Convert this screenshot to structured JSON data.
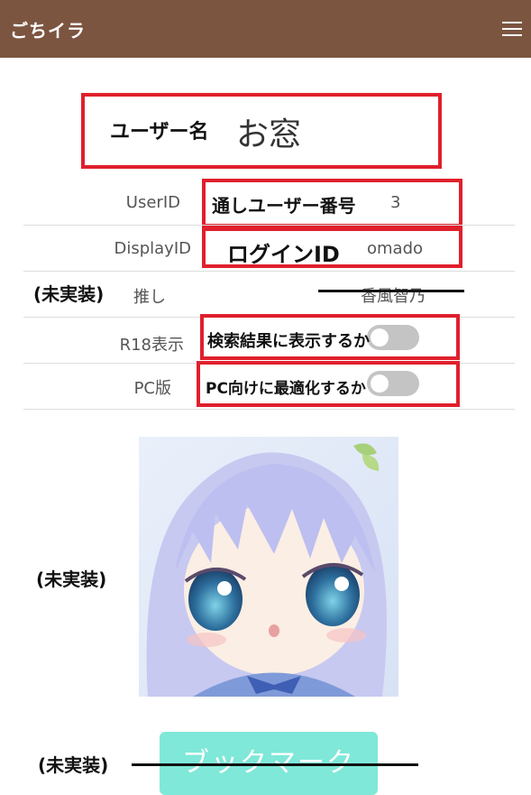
{
  "header": {
    "title": "ごちイラ",
    "menu_icon": "hamburger-menu-icon",
    "background": "#7c5541"
  },
  "profile": {
    "username_annotation": "ユーザー名",
    "username": "お窓",
    "rows": {
      "userid": {
        "label": "UserID",
        "annotation": "通しユーザー番号",
        "value": "3"
      },
      "displayid": {
        "label": "DisplayID",
        "annotation": "ログインID",
        "value": "omado"
      },
      "oshi": {
        "label": "推し",
        "annotation": "(未実装)",
        "value": "香風智乃"
      },
      "r18": {
        "label": "R18表示",
        "annotation": "検索結果に表示するか",
        "toggle_on": false
      },
      "pc": {
        "label": "PC版",
        "annotation": "PC向けに最適化するか",
        "toggle_on": false
      }
    }
  },
  "avatar": {
    "annotation": "(未実装)",
    "alt": "avatar-image"
  },
  "bookmark": {
    "annotation": "(未実装)",
    "label": "ブックマーク",
    "color": "#7fe8d8"
  },
  "annotation_color": "#e0202c"
}
